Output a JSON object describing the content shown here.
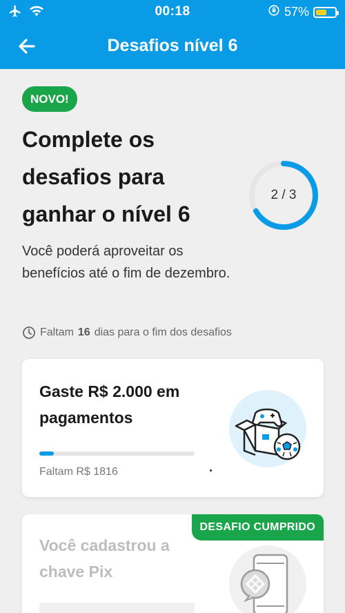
{
  "status_bar": {
    "time": "00:18",
    "battery_percent": "57%",
    "battery_level": 0.57,
    "icons": [
      "airplane-icon",
      "wifi-icon",
      "rotation-lock-icon",
      "battery-icon"
    ]
  },
  "header": {
    "title": "Desafios nível 6",
    "back_icon": "arrow-left-icon"
  },
  "intro": {
    "badge": "NOVO!",
    "headline": "Complete os desafios para ganhar o nível 6",
    "description": "Você poderá aproveitar os benefícios até o fim de dezembro.",
    "progress": {
      "done": 2,
      "total": 3,
      "label": "2 / 3"
    },
    "deadline": {
      "prefix": "Faltam",
      "days": "16",
      "suffix": "dias para o fim dos desafios",
      "icon": "clock-icon"
    }
  },
  "challenges": [
    {
      "title": "Gaste R$ 2.000 em pagamentos",
      "remaining": "Faltam R$ 1816",
      "progress_fraction": 0.092,
      "illustration": "gift-box-gamepad-ball-illustration",
      "completed": false
    },
    {
      "title": "Você cadastrou a chave Pix",
      "badge": "DESAFIO CUMPRIDO",
      "illustration": "phone-pix-illustration",
      "completed": true
    }
  ],
  "colors": {
    "primary": "#0a9be6",
    "success": "#1aa54a",
    "battery": "#f5cf28",
    "background": "#efefef"
  }
}
